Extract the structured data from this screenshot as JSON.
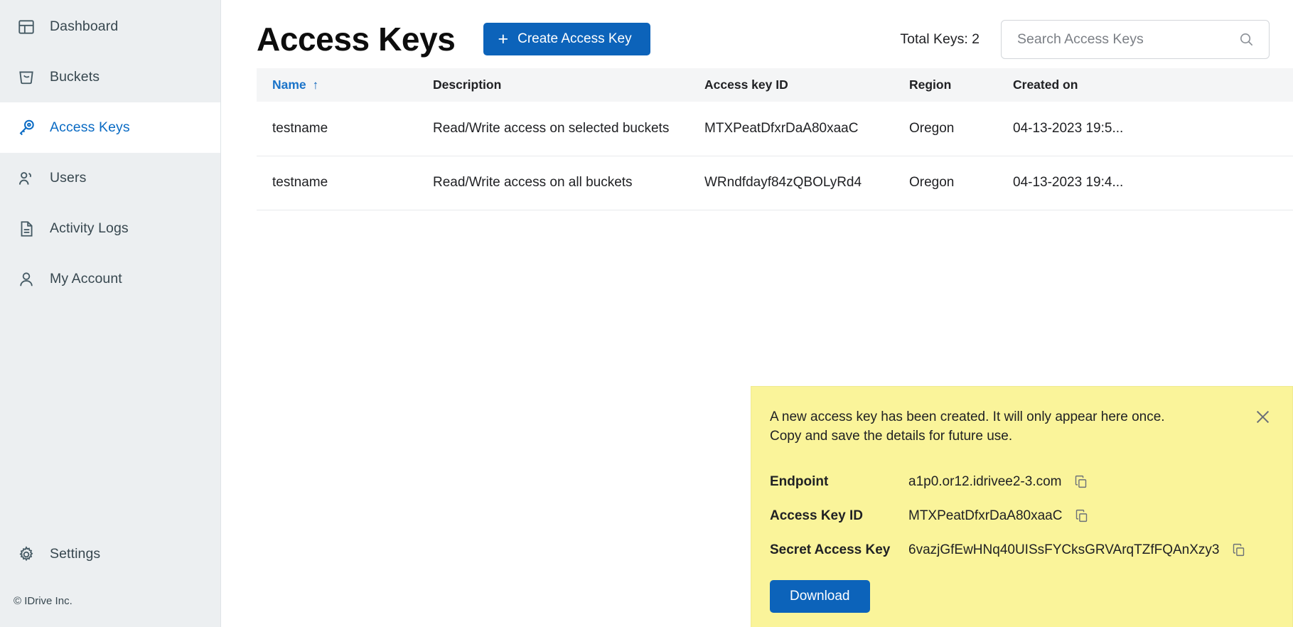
{
  "sidebar": {
    "items": [
      {
        "label": "Dashboard",
        "icon": "dashboard-icon",
        "active": false
      },
      {
        "label": "Buckets",
        "icon": "bucket-icon",
        "active": false
      },
      {
        "label": "Access Keys",
        "icon": "key-icon",
        "active": true
      },
      {
        "label": "Users",
        "icon": "users-icon",
        "active": false
      },
      {
        "label": "Activity Logs",
        "icon": "document-icon",
        "active": false
      },
      {
        "label": "My Account",
        "icon": "person-icon",
        "active": false
      }
    ],
    "settings": {
      "label": "Settings",
      "icon": "gear-icon"
    },
    "copyright": "© IDrive Inc."
  },
  "header": {
    "title": "Access Keys",
    "create_button": {
      "label": "Create Access Key",
      "icon": "plus-icon"
    },
    "total_keys": "Total Keys: 2",
    "search": {
      "placeholder": "Search Access Keys",
      "value": "",
      "icon": "search-icon"
    }
  },
  "table": {
    "columns": [
      {
        "key": "name",
        "label": "Name",
        "sortable": true,
        "sort": "asc"
      },
      {
        "key": "description",
        "label": "Description",
        "sortable": false
      },
      {
        "key": "access_key",
        "label": "Access key ID",
        "sortable": false
      },
      {
        "key": "region",
        "label": "Region",
        "sortable": false
      },
      {
        "key": "created",
        "label": "Created on",
        "sortable": false
      }
    ],
    "sort_arrow": "↑",
    "rows": [
      {
        "name": "testname",
        "description": "Read/Write access on selected buckets",
        "access_key": "MTXPeatDfxrDaA80xaaC",
        "region": "Oregon",
        "created": "04-13-2023 19:5..."
      },
      {
        "name": "testname",
        "description": "Read/Write access on all buckets",
        "access_key": "WRndfdayf84zQBOLyRd4",
        "region": "Oregon",
        "created": "04-13-2023 19:4..."
      }
    ]
  },
  "notification": {
    "message": "A new access key has been created. It will only appear here once. Copy and save the details for future use.",
    "close_icon": "close-icon",
    "fields": [
      {
        "label": "Endpoint",
        "value": "a1p0.or12.idrivee2-3.com",
        "copy_icon": "copy-icon"
      },
      {
        "label": "Access Key ID",
        "value": "MTXPeatDfxrDaA80xaaC",
        "copy_icon": "copy-icon"
      },
      {
        "label": "Secret Access Key",
        "value": "6vazjGfEwHNq40UISsFYCksGRVArqTZfFQAnXzy3",
        "copy_icon": "copy-icon"
      }
    ],
    "download_label": "Download"
  },
  "colors": {
    "accent": "#0c63ba",
    "sidebar_bg": "#eceff1",
    "notification_bg": "#faf49a",
    "link": "#1a73c9"
  }
}
